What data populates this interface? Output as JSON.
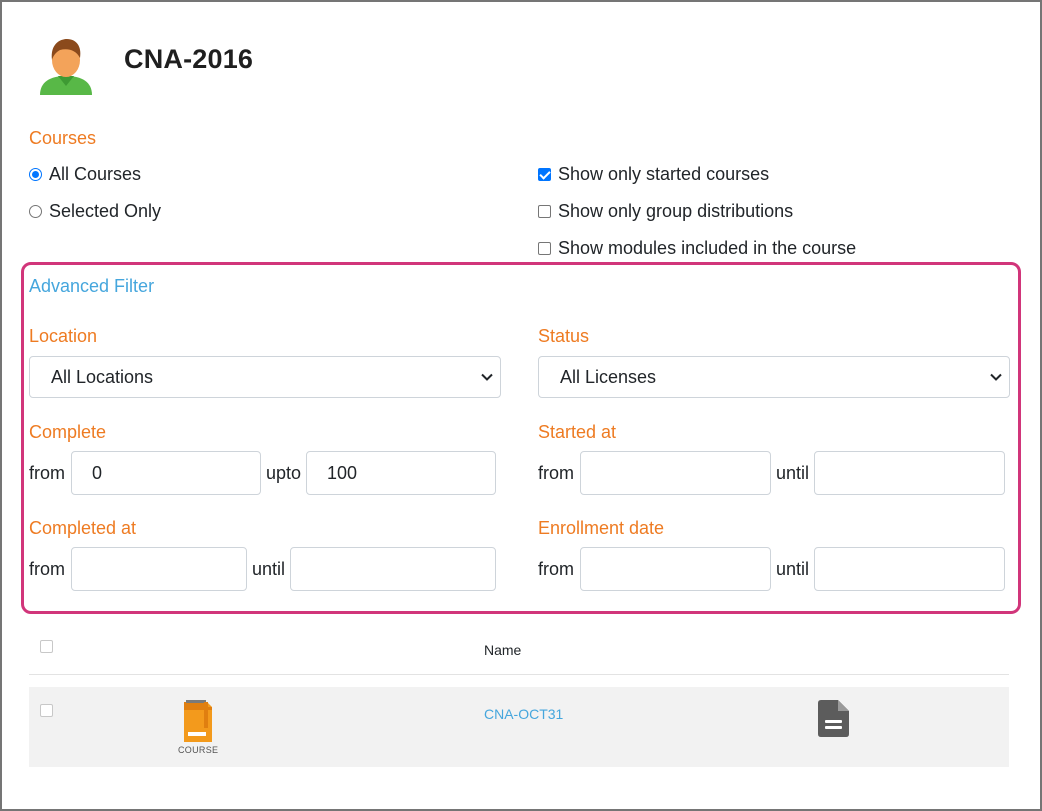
{
  "header": {
    "title": "CNA-2016",
    "avatar_icon": "user-avatar-icon"
  },
  "courses": {
    "section_label": "Courses",
    "radio_all": "All Courses",
    "radio_selected": "Selected Only",
    "selected_option": "All Courses",
    "checkbox_started": {
      "label": "Show only started courses",
      "checked": true
    },
    "checkbox_group": {
      "label": "Show only group distributions",
      "checked": false
    },
    "checkbox_modules": {
      "label": "Show modules included in the course",
      "checked": false
    }
  },
  "advanced_filter": {
    "title": "Advanced Filter",
    "highlight_color": "#d1357a",
    "location": {
      "label": "Location",
      "value": "All Locations"
    },
    "status": {
      "label": "Status",
      "value": "All Licenses"
    },
    "complete": {
      "label": "Complete",
      "from_label": "from",
      "from_value": "0",
      "upto_label": "upto",
      "upto_value": "100"
    },
    "started_at": {
      "label": "Started at",
      "from_label": "from",
      "until_label": "until",
      "from_value": "",
      "until_value": ""
    },
    "completed_at": {
      "label": "Completed at",
      "from_label": "from",
      "until_label": "until",
      "from_value": "",
      "until_value": ""
    },
    "enrollment_date": {
      "label": "Enrollment date",
      "from_label": "from",
      "until_label": "until",
      "from_value": "",
      "until_value": ""
    }
  },
  "table": {
    "columns": [
      "",
      "",
      "Name",
      ""
    ],
    "rows": [
      {
        "type_label": "COURSE",
        "name": "CNA-OCT31",
        "action_icon": "document-icon"
      }
    ]
  },
  "colors": {
    "accent_orange": "#ee7b22",
    "link_blue": "#45a6dd",
    "checkbox_blue": "#0075ff"
  }
}
